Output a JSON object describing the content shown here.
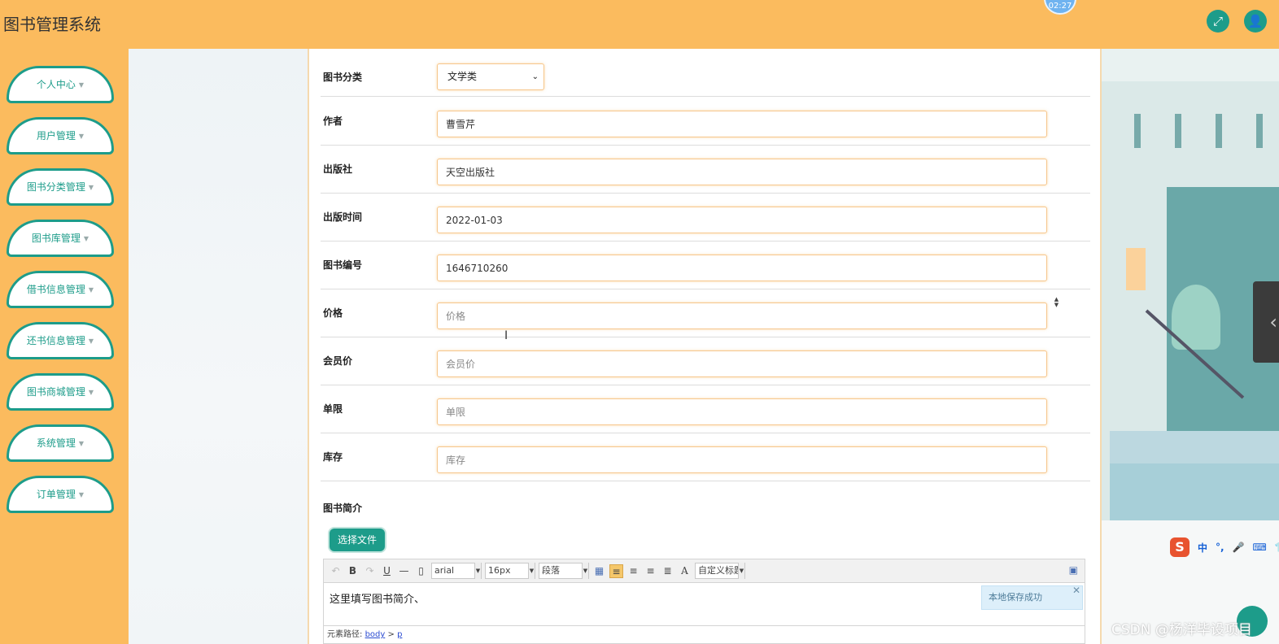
{
  "header": {
    "app_title": "图书管理系统",
    "clock": "02:27",
    "fullscreen_icon": "expand-icon",
    "user_icon": "user-icon"
  },
  "sidebar": {
    "items": [
      {
        "label": "个人中心"
      },
      {
        "label": "用户管理"
      },
      {
        "label": "图书分类管理"
      },
      {
        "label": "图书库管理"
      },
      {
        "label": "借书信息管理"
      },
      {
        "label": "还书信息管理"
      },
      {
        "label": "图书商城管理"
      },
      {
        "label": "系统管理"
      },
      {
        "label": "订单管理"
      }
    ]
  },
  "form": {
    "category": {
      "label": "图书分类",
      "value": "文学类"
    },
    "author": {
      "label": "作者",
      "value": "曹雪芹"
    },
    "publisher": {
      "label": "出版社",
      "value": "天空出版社"
    },
    "publish_date": {
      "label": "出版时间",
      "value": "2022-01-03"
    },
    "book_no": {
      "label": "图书编号",
      "value": "1646710260"
    },
    "price": {
      "label": "价格",
      "placeholder": "价格"
    },
    "member_price": {
      "label": "会员价",
      "placeholder": "会员价"
    },
    "limit": {
      "label": "单限",
      "placeholder": "单限"
    },
    "stock": {
      "label": "库存",
      "placeholder": "库存"
    },
    "intro": {
      "label": "图书简介"
    },
    "file_button": "选择文件"
  },
  "editor": {
    "font_family": "arial",
    "font_size": "16px",
    "paragraph": "段落",
    "custom_title": "自定义标题",
    "content": "这里填写图书简介、",
    "toast": "本地保存成功",
    "path_label": "元素路径:",
    "path_body": "body",
    "path_sep": ">",
    "path_p": "p"
  },
  "ime": {
    "label": "中"
  },
  "watermark": "CSDN @杨洋毕设项目",
  "colors": {
    "header": "#fbbb5e",
    "accent": "#1d9c8a",
    "field_border": "#f6c68c"
  }
}
